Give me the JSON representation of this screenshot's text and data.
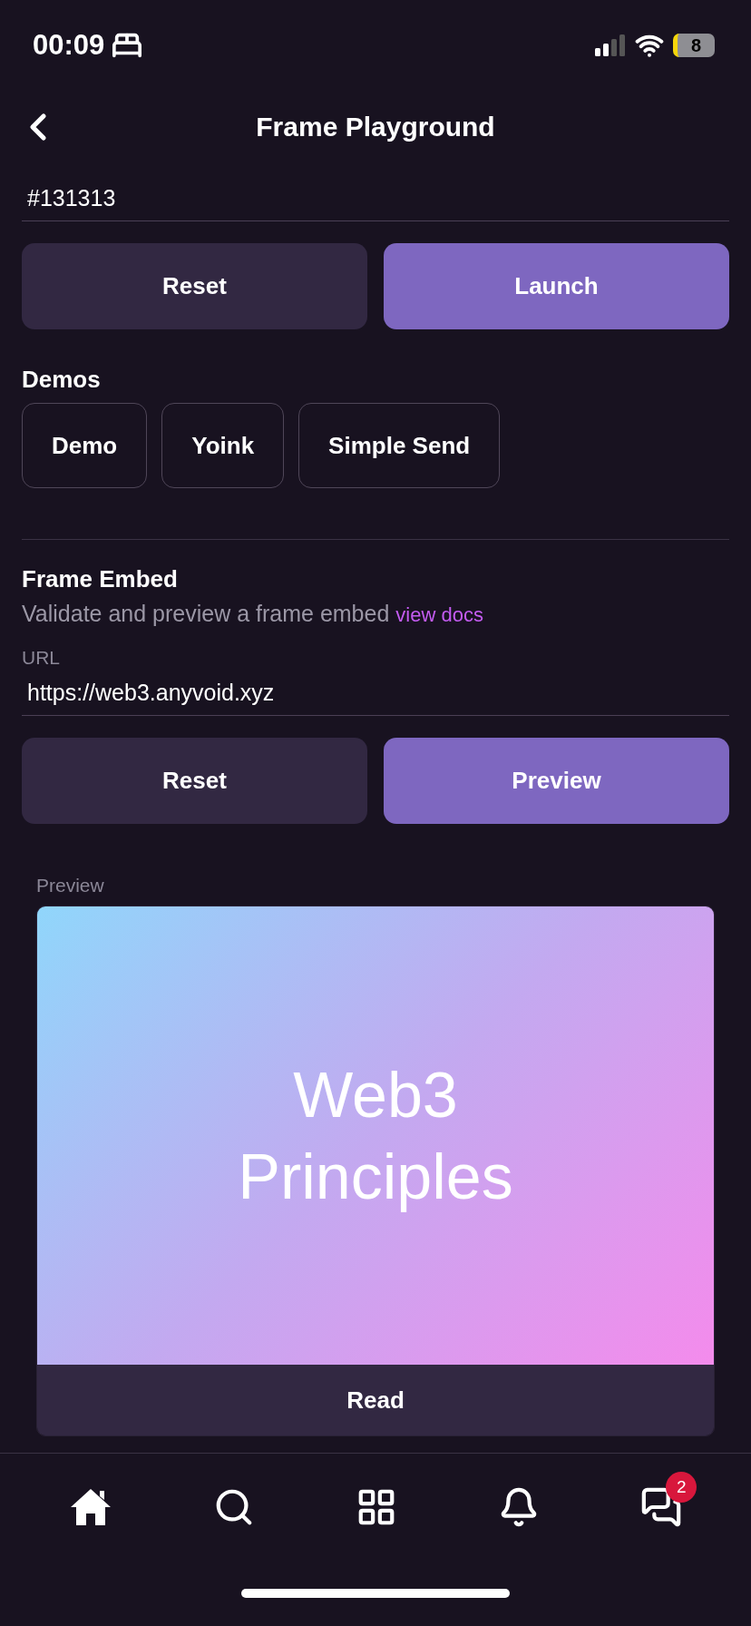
{
  "status_bar": {
    "time": "00:09",
    "battery": "8"
  },
  "nav": {
    "title": "Frame Playground"
  },
  "color_field": {
    "value": "#131313"
  },
  "top_buttons": [
    {
      "label": "Reset",
      "kind": "secondary"
    },
    {
      "label": "Launch",
      "kind": "primary"
    }
  ],
  "demos": {
    "title": "Demos",
    "items": [
      "Demo",
      "Yoink",
      "Simple Send"
    ]
  },
  "frame_embed": {
    "title": "Frame Embed",
    "description": "Validate and preview a frame embed",
    "link": "view docs",
    "url_label": "URL",
    "url_value": "https://web3.anyvoid.xyz",
    "buttons": [
      {
        "label": "Reset",
        "kind": "secondary"
      },
      {
        "label": "Preview",
        "kind": "primary"
      }
    ]
  },
  "preview": {
    "label": "Preview",
    "image_text": [
      "Web3",
      "Principles"
    ],
    "action": "Read"
  },
  "tab_bar": [
    {
      "kind": "home",
      "selected": true
    },
    {
      "kind": "search",
      "selected": false
    },
    {
      "kind": "apps",
      "selected": false
    },
    {
      "kind": "notifications",
      "selected": false
    },
    {
      "kind": "messages",
      "selected": false,
      "badge": "2"
    }
  ]
}
